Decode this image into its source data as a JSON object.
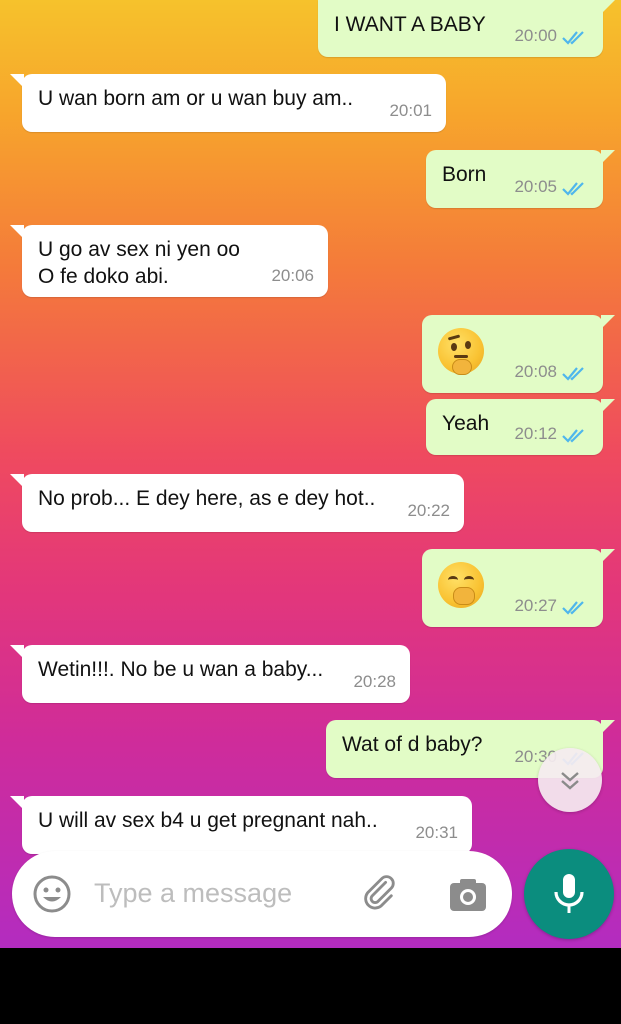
{
  "messages": [
    {
      "dir": "out",
      "text": "I WANT A BABY",
      "time": "20:00",
      "read": true
    },
    {
      "dir": "in",
      "text": "U wan born am or u wan buy am..",
      "time": "20:01"
    },
    {
      "dir": "out",
      "text": "Born",
      "time": "20:05",
      "read": true
    },
    {
      "dir": "in",
      "lines": [
        "U go av sex ni yen oo",
        "O fe doko abi."
      ],
      "time": "20:06"
    },
    {
      "dir": "out",
      "emoji": "thinking-face-emoji",
      "time": "20:08",
      "read": true
    },
    {
      "dir": "out",
      "text": "Yeah",
      "time": "20:12",
      "read": true
    },
    {
      "dir": "in",
      "text": "No prob... E dey here, as e dey hot..",
      "time": "20:22"
    },
    {
      "dir": "out",
      "emoji": "face-with-hand-over-mouth-emoji",
      "time": "20:27",
      "read": true
    },
    {
      "dir": "in",
      "text": "Wetin!!!. No be u wan a baby...",
      "time": "20:28"
    },
    {
      "dir": "out",
      "text": "Wat of d baby?",
      "time": "20:30",
      "read": true
    },
    {
      "dir": "in",
      "text": "U will av sex b4 u get pregnant nah..",
      "time": "20:31"
    }
  ],
  "input": {
    "placeholder": "Type a message"
  },
  "colors": {
    "sent_bubble": "#e2fcc6",
    "received_bubble": "#ffffff",
    "read_tick": "#4fb6ec",
    "mic_button": "#0b8d7e"
  }
}
